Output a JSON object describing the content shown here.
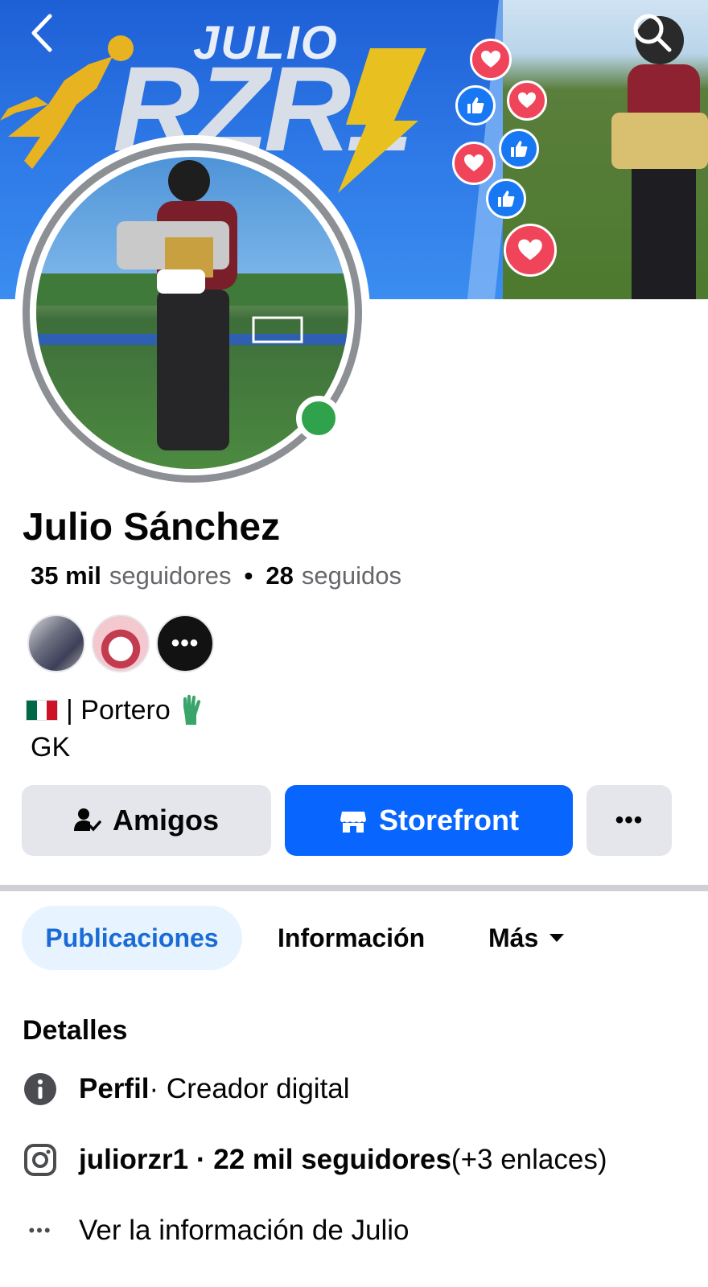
{
  "cover": {
    "banner_title": "JULIO",
    "banner_logo": "RZR1",
    "reactions": [
      "heart",
      "like",
      "heart",
      "heart",
      "like",
      "like",
      "heart"
    ]
  },
  "nav": {
    "back_icon": "chevron-left-icon",
    "search_icon": "search-icon"
  },
  "profile": {
    "name": "Julio Sánchez",
    "followers_count": "35 mil",
    "followers_label": "seguidores",
    "separator": "•",
    "following_count": "28",
    "following_label": "seguidos",
    "online": true,
    "more_friends": "•••",
    "bio_line1": "| Portero",
    "bio_line2": "GK"
  },
  "actions": {
    "friends_label": "Amigos",
    "storefront_label": "Storefront",
    "more_label": "•••"
  },
  "tabs": {
    "posts": "Publicaciones",
    "info": "Información",
    "more": "Más"
  },
  "details": {
    "title": "Detalles",
    "profile_bold": "Perfil",
    "profile_rest": " · Creador digital",
    "instagram_bold": "juliorzr1 · 22 mil seguidores",
    "instagram_rest": " (+3 enlaces)",
    "view_info": "Ver la información de Julio",
    "dots": "•••"
  },
  "colors": {
    "primary": "#0866ff",
    "online": "#31a24c",
    "tab_active_bg": "#e7f3ff",
    "tab_active_text": "#1a6bd6"
  }
}
